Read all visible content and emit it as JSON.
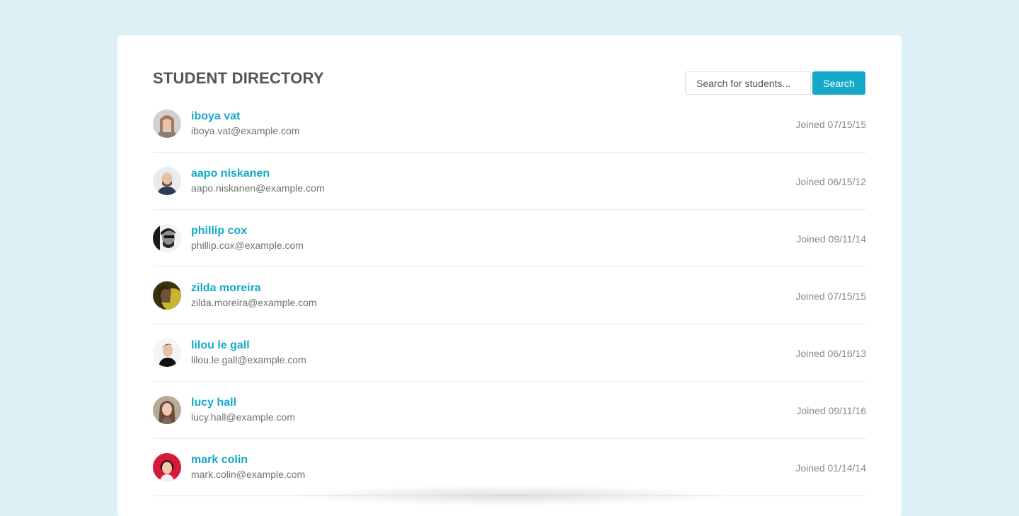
{
  "page": {
    "title": "STUDENT DIRECTORY"
  },
  "search": {
    "placeholder": "Search for students...",
    "button_label": "Search"
  },
  "students": [
    {
      "name": "iboya vat",
      "email": "iboya.vat@example.com",
      "joined": "Joined 07/15/15",
      "avatar_color": "#a98f87"
    },
    {
      "name": "aapo niskanen",
      "email": "aapo.niskanen@example.com",
      "joined": "Joined 06/15/12",
      "avatar_color": "#2c3b55"
    },
    {
      "name": "phillip cox",
      "email": "phillip.cox@example.com",
      "joined": "Joined 09/11/14",
      "avatar_color": "#3a3a3a"
    },
    {
      "name": "zilda moreira",
      "email": "zilda.moreira@example.com",
      "joined": "Joined 07/15/15",
      "avatar_color": "#b9a12e"
    },
    {
      "name": "lilou le gall",
      "email": "lilou.le gall@example.com",
      "joined": "Joined 06/16/13",
      "avatar_color": "#e8e4e0"
    },
    {
      "name": "lucy hall",
      "email": "lucy.hall@example.com",
      "joined": "Joined 09/11/16",
      "avatar_color": "#8e7f70"
    },
    {
      "name": "mark colin",
      "email": "mark.colin@example.com",
      "joined": "Joined 01/14/14",
      "avatar_color": "#d8183a"
    }
  ],
  "colors": {
    "background": "#dcf0f6",
    "accent": "#15a9c9",
    "card": "#ffffff"
  }
}
